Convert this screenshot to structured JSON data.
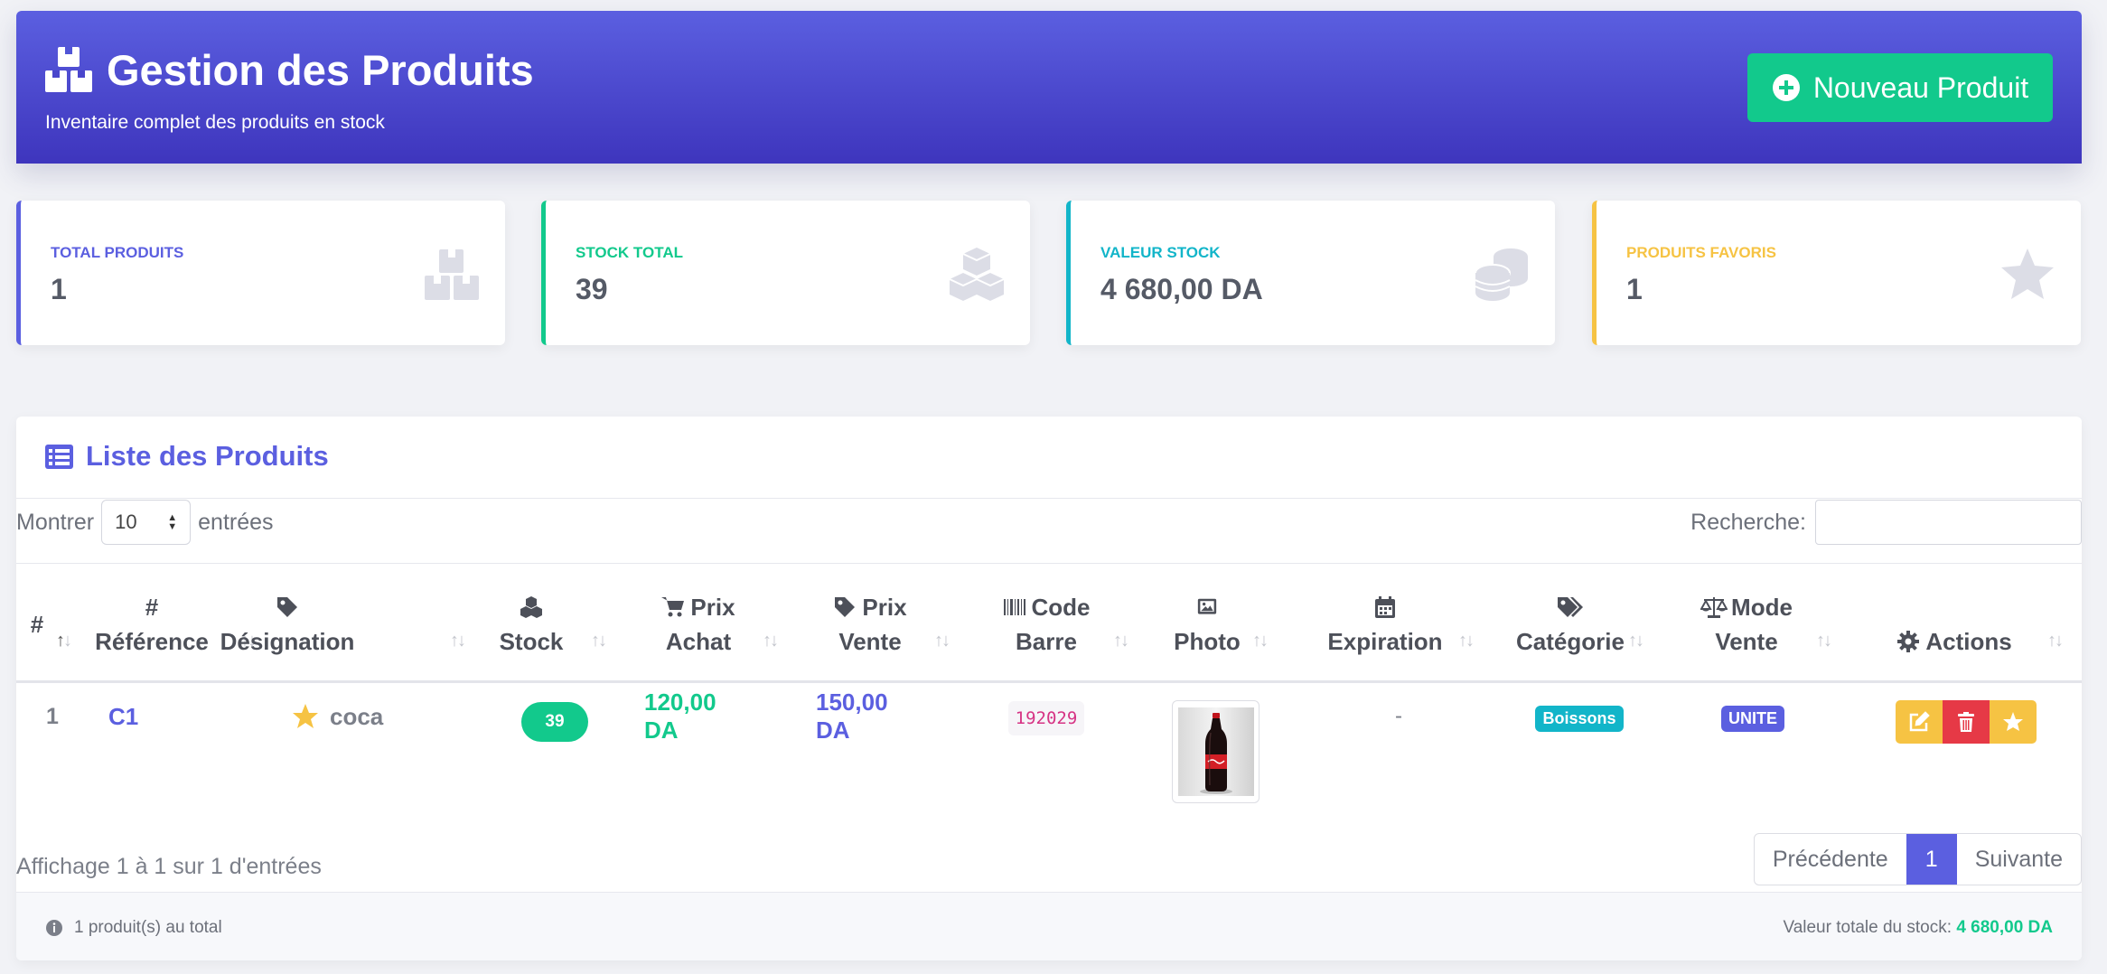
{
  "header": {
    "title": "Gestion des Produits",
    "subtitle": "Inventaire complet des produits en stock",
    "new_button": "Nouveau Produit"
  },
  "stats": [
    {
      "label": "TOTAL PRODUITS",
      "value": "1",
      "color": "#5b5fe0",
      "icon": "boxes-icon"
    },
    {
      "label": "STOCK TOTAL",
      "value": "39",
      "color": "#12c98c",
      "icon": "cubes-icon"
    },
    {
      "label": "VALEUR STOCK",
      "value": "4 680,00 DA",
      "color": "#12b5c9",
      "icon": "coins-icon"
    },
    {
      "label": "PRODUITS FAVORIS",
      "value": "1",
      "color": "#f6c343",
      "icon": "star-icon"
    }
  ],
  "list": {
    "title": "Liste des Produits",
    "show_label": "Montrer",
    "page_length": "10",
    "entries_label": "entrées",
    "search_label": "Recherche:",
    "search_value": ""
  },
  "columns": [
    {
      "line1": "#",
      "line2": ""
    },
    {
      "line1": "#",
      "line2": "Référence"
    },
    {
      "line1": "",
      "line2": "Désignation"
    },
    {
      "line1": "",
      "line2": "Stock"
    },
    {
      "line1": "Prix",
      "line2": "Achat"
    },
    {
      "line1": "Prix",
      "line2": "Vente"
    },
    {
      "line1": "Code",
      "line2": "Barre"
    },
    {
      "line1": "",
      "line2": "Photo"
    },
    {
      "line1": "",
      "line2": "Expiration"
    },
    {
      "line1": "",
      "line2": "Catégorie"
    },
    {
      "line1": "Mode",
      "line2": "Vente"
    },
    {
      "line1": "Actions",
      "line2": ""
    }
  ],
  "rows": [
    {
      "index": "1",
      "reference": "C1",
      "designation": "coca",
      "favorite": true,
      "stock": "39",
      "prix_achat": "120,00 DA",
      "prix_vente": "150,00 DA",
      "code_barre": "192029",
      "expiration": "-",
      "categorie": "Boissons",
      "mode_vente": "UNITE"
    }
  ],
  "pagination": {
    "info": "Affichage 1 à 1 sur 1 d'entrées",
    "prev": "Précédente",
    "current": "1",
    "next": "Suivante"
  },
  "footer": {
    "total_text": "1 produit(s) au total",
    "stock_value_label": "Valeur totale du stock:",
    "stock_value": "4 680,00 DA"
  },
  "colors": {
    "primary": "#5b5fe0",
    "success": "#12c98c",
    "info": "#12b5c9",
    "warning": "#f6c343",
    "danger": "#e63946"
  }
}
